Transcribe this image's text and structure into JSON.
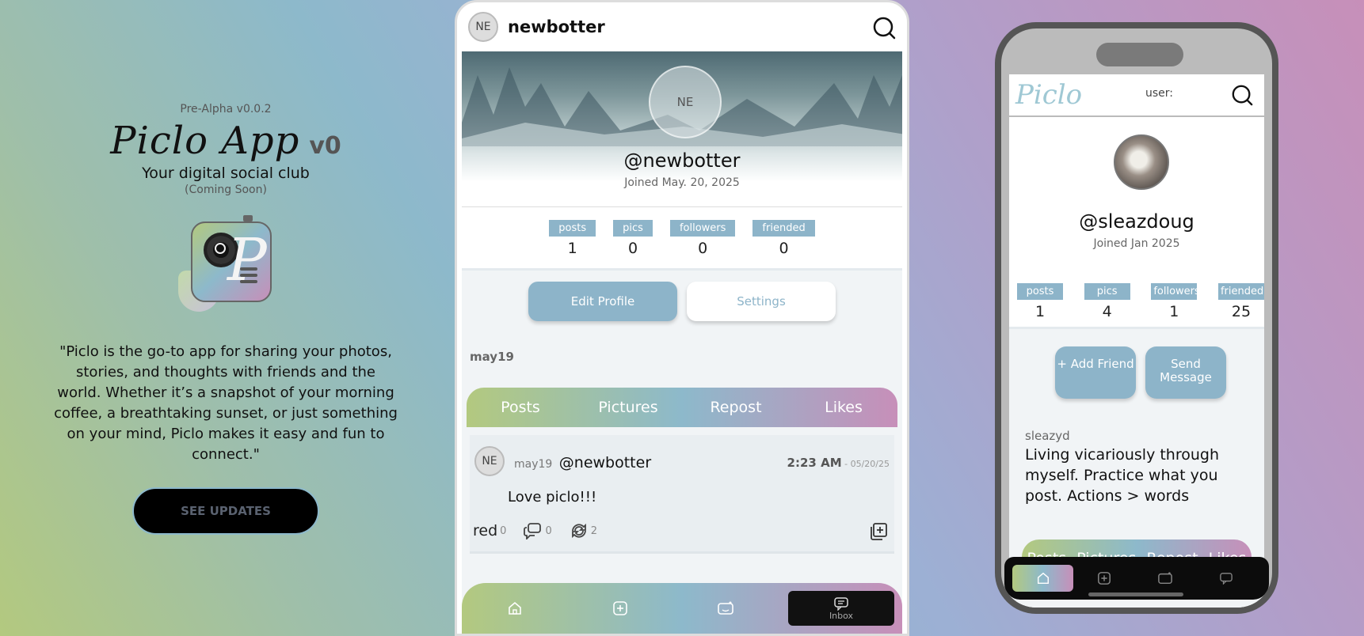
{
  "hero": {
    "version": "Pre-Alpha v0.0.2",
    "title": "Piclo App",
    "title_version": "v0",
    "tagline": "Your digital social club",
    "coming_soon": "(Coming Soon)",
    "quote": "\"Piclo is the go-to app for sharing your photos, stories, and thoughts with friends and the world. Whether it’s a snapshot of your morning coffee, a breathtaking sunset, or just something on your mind, Piclo makes it easy and fun to connect.\"",
    "updates_button": "SEE UPDATES"
  },
  "center_phone": {
    "header": {
      "avatar_initials": "NE",
      "username": "newbotter"
    },
    "profile": {
      "avatar_initials": "NE",
      "handle": "@newbotter",
      "joined": "Joined May. 20, 2025"
    },
    "stats": [
      {
        "label": "posts",
        "value": "1"
      },
      {
        "label": "pics",
        "value": "0"
      },
      {
        "label": "followers",
        "value": "0"
      },
      {
        "label": "friended",
        "value": "0"
      }
    ],
    "buttons": {
      "edit": "Edit Profile",
      "settings": "Settings"
    },
    "bio_name": "may19",
    "tabs": [
      "Posts",
      "Pictures",
      "Repost",
      "Likes"
    ],
    "post": {
      "avatar_initials": "NE",
      "display_name": "may19",
      "username": "@newbotter",
      "time": "2:23 AM",
      "date_sep": " - ",
      "date": "05/20/25",
      "text": "Love piclo!!!",
      "like_label": "red",
      "like_count": "0",
      "comment_count": "0",
      "repost_count": "2"
    },
    "nav": {
      "inbox_label": "Inbox"
    }
  },
  "right_phone": {
    "logo": "Piclo",
    "user_label": "user:",
    "handle": "@sleazdoug",
    "joined": "Joined Jan 2025",
    "stats": [
      {
        "label": "posts",
        "value": "1"
      },
      {
        "label": "pics",
        "value": "4"
      },
      {
        "label": "followers",
        "value": "1"
      },
      {
        "label": "friended",
        "value": "25"
      }
    ],
    "buttons": {
      "add_friend": "+ Add Friend",
      "send_message": "Send Message"
    },
    "bio_name": "sleazyd",
    "bio": "Living vicariously through myself. Practice what you post. Actions > words",
    "tabs": [
      "Posts",
      "Pictures",
      "Repost",
      "Likes"
    ]
  },
  "colors": {
    "accent_blue": "#8db4c9",
    "gradient_green": "#b3c97f",
    "gradient_pink": "#c78fb9"
  },
  "icons": [
    "search-icon",
    "home-icon",
    "add-post-icon",
    "camera-icon",
    "inbox-icon",
    "like-icon",
    "comment-icon",
    "repost-icon",
    "share-icon"
  ]
}
